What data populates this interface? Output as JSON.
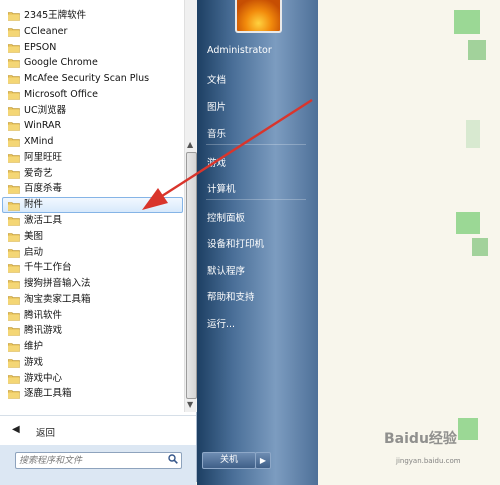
{
  "programs": [
    {
      "label": "2345王牌软件"
    },
    {
      "label": "CCleaner"
    },
    {
      "label": "EPSON"
    },
    {
      "label": "Google Chrome"
    },
    {
      "label": "McAfee Security Scan Plus"
    },
    {
      "label": "Microsoft Office"
    },
    {
      "label": "UC浏览器"
    },
    {
      "label": "WinRAR"
    },
    {
      "label": "XMind"
    },
    {
      "label": "阿里旺旺"
    },
    {
      "label": "爱奇艺"
    },
    {
      "label": "百度杀毒"
    },
    {
      "label": "附件"
    },
    {
      "label": "激活工具"
    },
    {
      "label": "美图"
    },
    {
      "label": "启动"
    },
    {
      "label": "千牛工作台"
    },
    {
      "label": "搜狗拼音输入法"
    },
    {
      "label": "淘宝卖家工具箱"
    },
    {
      "label": "腾讯软件"
    },
    {
      "label": "腾讯游戏"
    },
    {
      "label": "维护"
    },
    {
      "label": "游戏"
    },
    {
      "label": "游戏中心"
    },
    {
      "label": "逐鹿工具箱"
    }
  ],
  "selected_index": 12,
  "back_label": "返回",
  "search_placeholder": "搜索程序和文件",
  "right_items": {
    "user": "Administrator",
    "documents": "文档",
    "pictures": "图片",
    "music": "音乐",
    "games": "游戏",
    "computer": "计算机",
    "control_panel": "控制面板",
    "devices": "设备和打印机",
    "default_programs": "默认程序",
    "help": "帮助和支持",
    "run": "运行..."
  },
  "shutdown_label": "关机",
  "watermark": "Baidu经验",
  "watermark_sub": "jingyan.baidu.com",
  "colors": {
    "arrow": "#d9352c",
    "selection": "#cde4fa",
    "right_pane": "#4a6f98"
  },
  "icons": {
    "folder": "folder-icon",
    "search": "search-icon",
    "back": "back-arrow-icon",
    "shutdown_options": "triangle-right-icon"
  }
}
